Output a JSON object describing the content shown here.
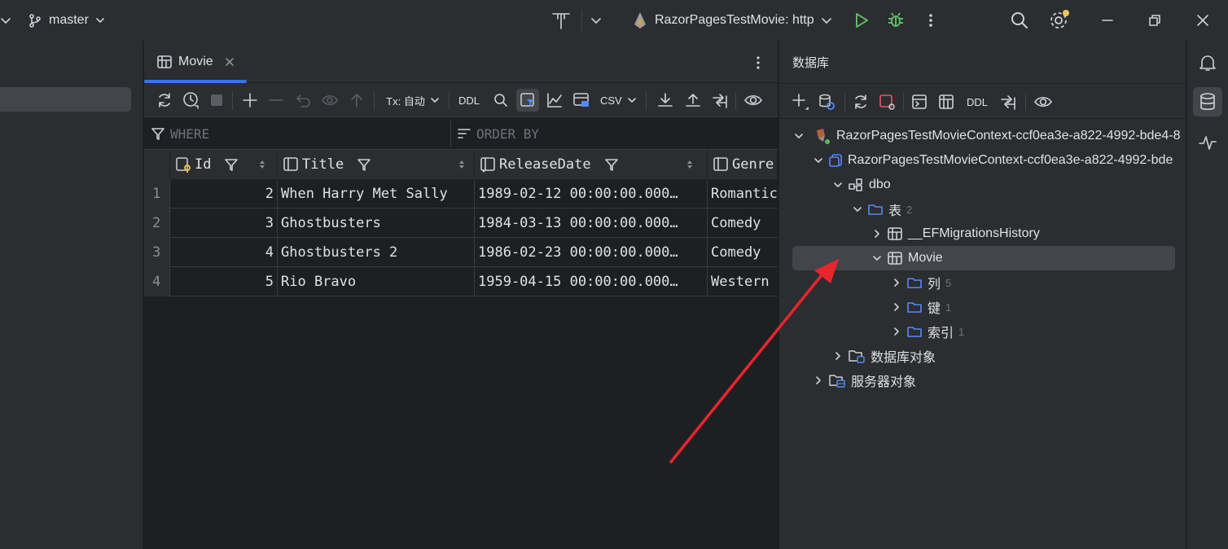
{
  "titlebar": {
    "branch": "master",
    "run_config": "RazorPagesTestMovie: http"
  },
  "editor": {
    "tab_label": "Movie",
    "toolbar": {
      "tx_label": "Tx: 自动",
      "ddl_label": "DDL",
      "csv_label": "CSV"
    },
    "filter": {
      "where_placeholder": "WHERE",
      "orderby_placeholder": "ORDER BY"
    },
    "columns": [
      "Id",
      "Title",
      "ReleaseDate",
      "Genre"
    ],
    "rows": [
      {
        "num": "1",
        "id": "2",
        "title": "When Harry Met Sally",
        "release": "1989-02-12 00:00:00.000…",
        "genre": "Romantic"
      },
      {
        "num": "2",
        "id": "3",
        "title": "Ghostbusters",
        "release": "1984-03-13 00:00:00.000…",
        "genre": "Comedy"
      },
      {
        "num": "3",
        "id": "4",
        "title": "Ghostbusters 2",
        "release": "1986-02-23 00:00:00.000…",
        "genre": "Comedy"
      },
      {
        "num": "4",
        "id": "5",
        "title": "Rio Bravo",
        "release": "1959-04-15 00:00:00.000…",
        "genre": "Western"
      }
    ]
  },
  "db": {
    "title": "数据库",
    "toolbar_ddl": "DDL",
    "tree": {
      "datasource": "RazorPagesTestMovieContext-ccf0ea3e-a822-4992-bde4-8",
      "database": "RazorPagesTestMovieContext-ccf0ea3e-a822-4992-bde",
      "schema": "dbo",
      "tables_label": "表",
      "tables_count": "2",
      "table1": "__EFMigrationsHistory",
      "table2": "Movie",
      "columns_label": "列",
      "columns_count": "5",
      "keys_label": "键",
      "keys_count": "1",
      "indexes_label": "索引",
      "indexes_count": "1",
      "db_objects": "数据库对象",
      "server_objects": "服务器对象"
    }
  },
  "colors": {
    "accent": "#3574f0",
    "folder": "#548af7",
    "run": "#5fb865",
    "annotation_arrow": "#e8262d",
    "badge": "#f2c55c"
  }
}
